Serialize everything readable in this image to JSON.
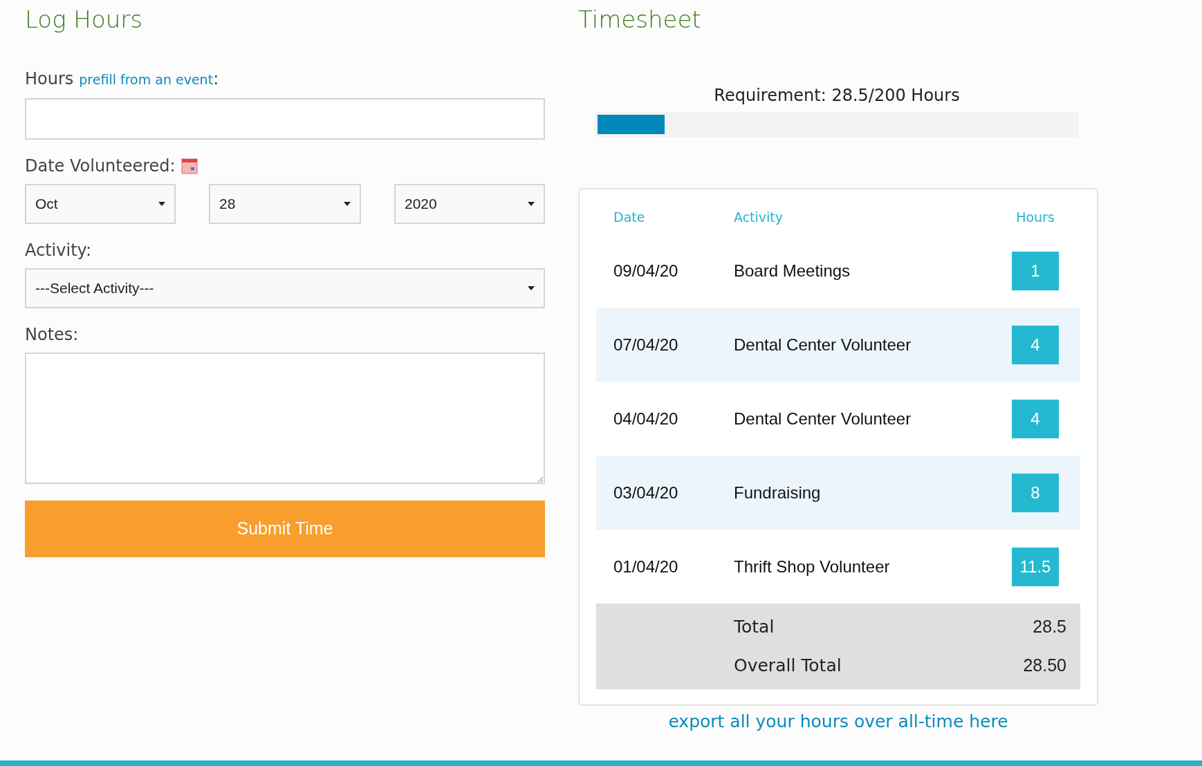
{
  "log_hours": {
    "title": "Log Hours",
    "hours_label": "Hours",
    "prefill_link": "prefill from an event",
    "hours_colon": ":",
    "date_label": "Date Volunteered:",
    "month": "Oct",
    "day": "28",
    "year": "2020",
    "activity_label": "Activity:",
    "activity_value": "---Select Activity---",
    "notes_label": "Notes:",
    "submit": "Submit Time"
  },
  "timesheet": {
    "title": "Timesheet",
    "requirement": "Requirement: 28.5/200 Hours",
    "progress": {
      "level": 0.14
    },
    "columns": [
      "Date",
      "Activity",
      "Hours"
    ],
    "rows": [
      {
        "date": "09/04/20",
        "activity": "Board Meetings",
        "hours": "1"
      },
      {
        "date": "07/04/20",
        "activity": "Dental Center Volunteer",
        "hours": "4"
      },
      {
        "date": "04/04/20",
        "activity": "Dental Center Volunteer",
        "hours": "4"
      },
      {
        "date": "03/04/20",
        "activity": "Fundraising",
        "hours": "8"
      },
      {
        "date": "01/04/20",
        "activity": "Thrift Shop Volunteer",
        "hours": "11.5"
      }
    ],
    "totals": [
      {
        "label": "Total",
        "value": "28.5"
      },
      {
        "label": "Overall Total",
        "value": "28.50"
      }
    ],
    "export_link": "export all your hours over all-time here"
  }
}
